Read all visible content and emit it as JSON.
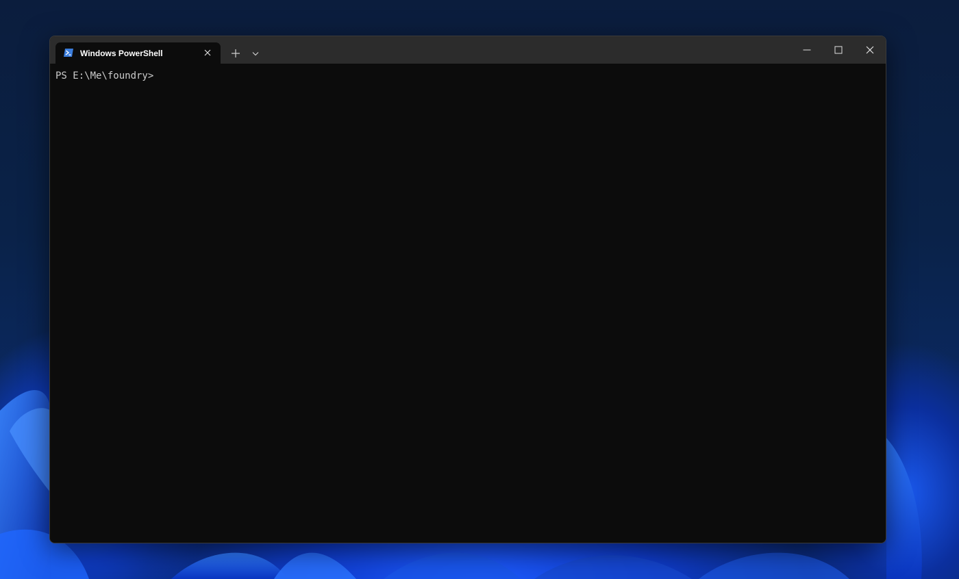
{
  "window": {
    "tab_title": "Windows PowerShell",
    "tab_icon": "powershell-icon",
    "new_tab_icon": "plus-icon",
    "dropdown_icon": "chevron-down-icon",
    "minimize_icon": "minimize-icon",
    "maximize_icon": "maximize-icon",
    "close_icon": "close-icon"
  },
  "terminal": {
    "prompt": "PS E:\\Me\\foundry>"
  },
  "colors": {
    "titlebar": "#2c2c2c",
    "terminal_bg": "#0c0c0c",
    "text": "#cccccc",
    "accent": "#1e5cff"
  }
}
